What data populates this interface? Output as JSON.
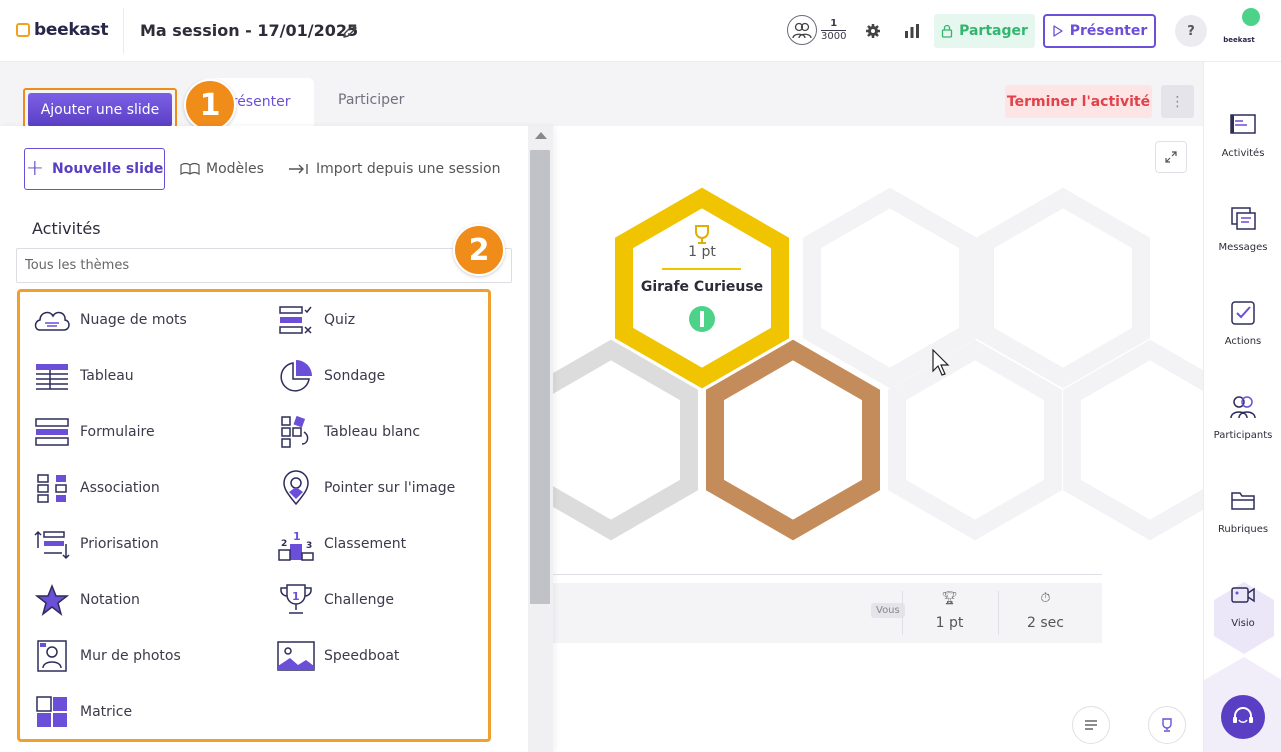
{
  "brand": {
    "name": "beekast",
    "accent": "#6b4fd8",
    "highlight": "#f08c1a"
  },
  "header": {
    "session_title": "Ma session - 17/01/2025",
    "participants_current": "1",
    "participants_max": "3000",
    "share_label": "Partager",
    "present_label": "Présenter",
    "help_label": "?",
    "user_brand": "beekast"
  },
  "tabs": {
    "add_slide_label": "Ajouter une slide",
    "present_label": "Présenter",
    "participate_label": "Participer",
    "end_activity_label": "Terminer l'activité",
    "more_label": "⋮"
  },
  "badges": {
    "one": "1",
    "two": "2"
  },
  "drawer": {
    "new_slide_label": "Nouvelle slide",
    "templates_label": "Modèles",
    "import_label": "Import depuis une session",
    "activities_heading": "Activités",
    "theme_placeholder": "Tous les thèmes",
    "activities": [
      {
        "label": "Nuage de mots",
        "icon": "word-cloud-icon"
      },
      {
        "label": "Quiz",
        "icon": "quiz-icon"
      },
      {
        "label": "Tableau",
        "icon": "table-icon"
      },
      {
        "label": "Sondage",
        "icon": "poll-icon"
      },
      {
        "label": "Formulaire",
        "icon": "form-icon"
      },
      {
        "label": "Tableau blanc",
        "icon": "whiteboard-icon"
      },
      {
        "label": "Association",
        "icon": "association-icon"
      },
      {
        "label": "Pointer sur l'image",
        "icon": "image-pointer-icon"
      },
      {
        "label": "Priorisation",
        "icon": "prioritization-icon"
      },
      {
        "label": "Classement",
        "icon": "ranking-podium-icon"
      },
      {
        "label": "Notation",
        "icon": "rating-star-icon"
      },
      {
        "label": "Challenge",
        "icon": "challenge-trophy-icon"
      },
      {
        "label": "Mur de photos",
        "icon": "photo-wall-icon"
      },
      {
        "label": "Speedboat",
        "icon": "speedboat-icon"
      },
      {
        "label": "Matrice",
        "icon": "matrix-icon"
      }
    ]
  },
  "leaderboard": {
    "points": "1 pt",
    "player_name": "Girafe Curieuse",
    "you_label": "Vous",
    "result_points": "1 pt",
    "result_time": "2 sec"
  },
  "right_sidebar": {
    "items": [
      {
        "label": "Activités",
        "icon": "activities-icon"
      },
      {
        "label": "Messages",
        "icon": "messages-icon"
      },
      {
        "label": "Actions",
        "icon": "actions-checkbox-icon"
      },
      {
        "label": "Participants",
        "icon": "participants-icon"
      },
      {
        "label": "Rubriques",
        "icon": "sections-folder-icon"
      },
      {
        "label": "Visio",
        "icon": "video-camera-icon"
      }
    ]
  },
  "colors": {
    "gold": "#f0c400",
    "bronze": "#c48c5a",
    "silver": "#dcdcdc",
    "end_red": "#e2424a",
    "share_green": "#33b56e"
  }
}
